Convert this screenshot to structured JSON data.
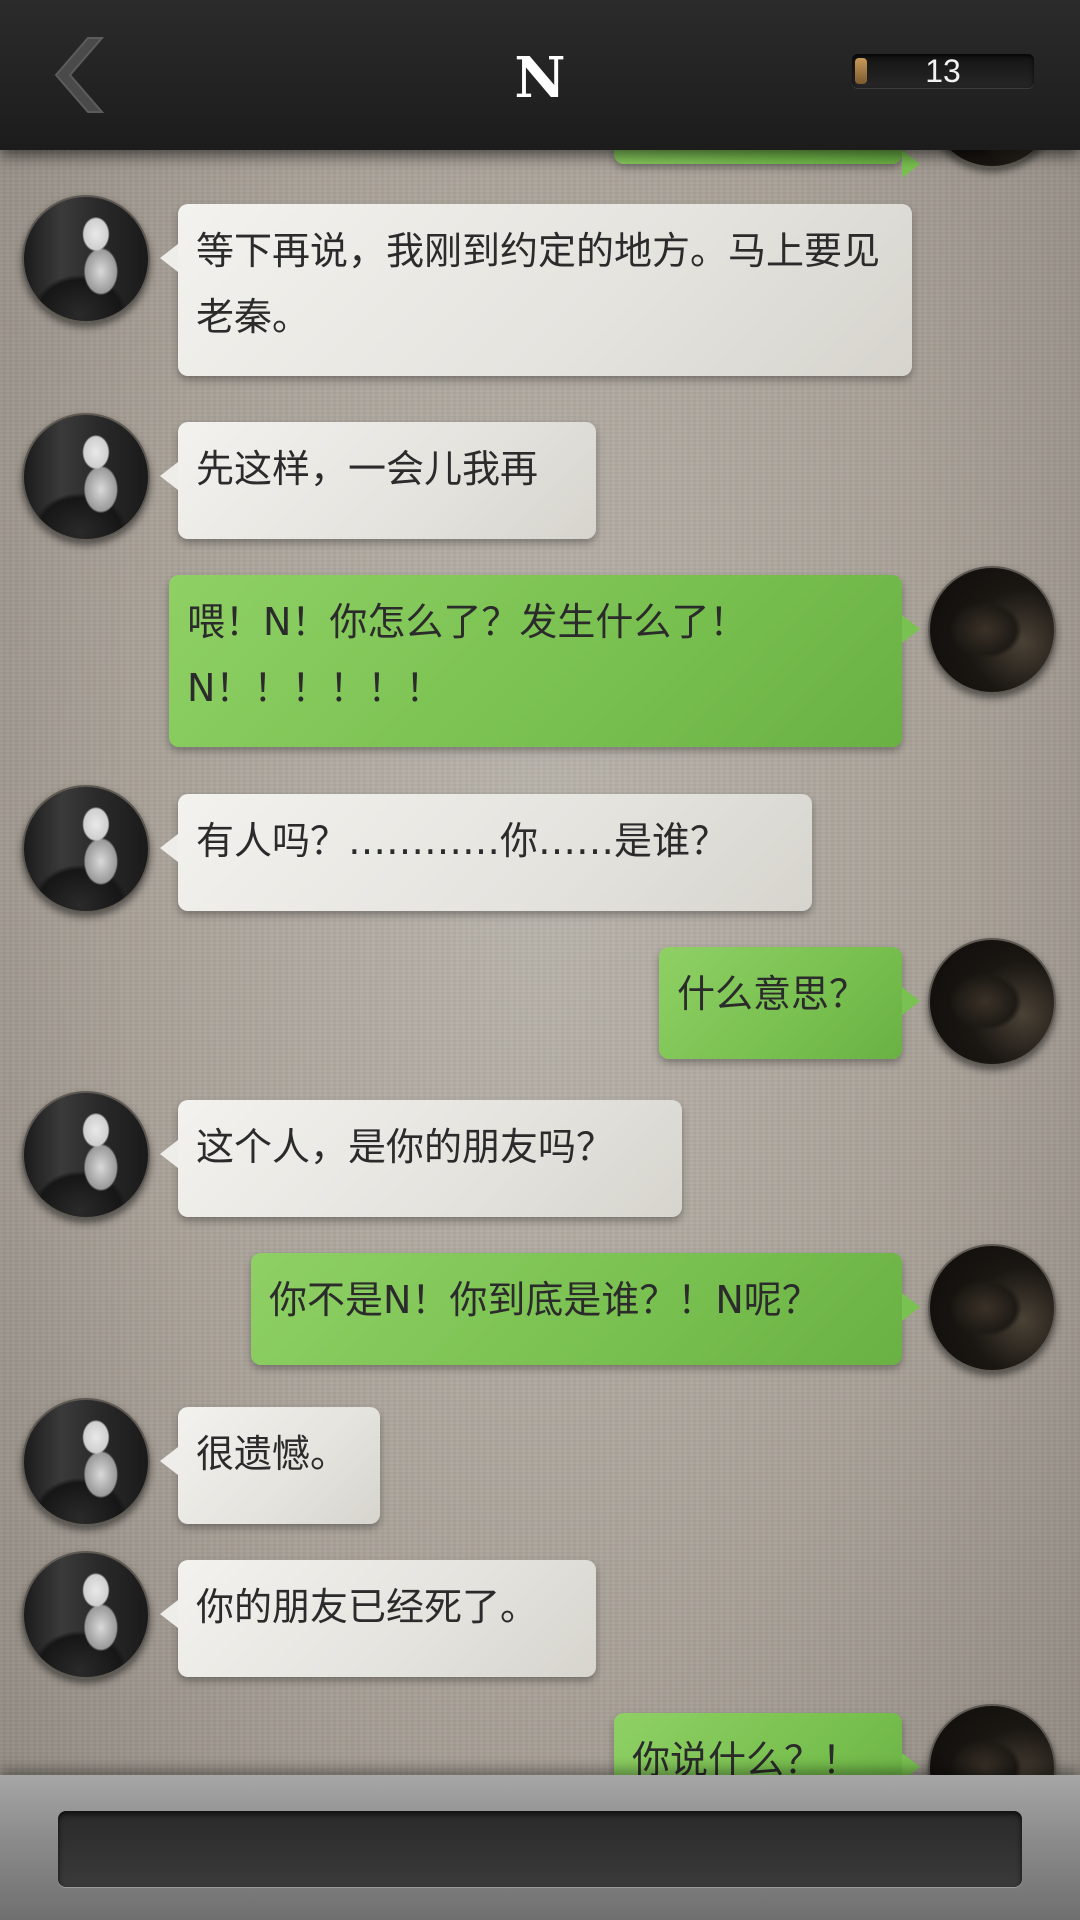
{
  "header": {
    "title": "N",
    "counter_value": "13",
    "counter_fill_fraction": 0.07
  },
  "messages": [
    {
      "sender": "me",
      "text": ""
    },
    {
      "sender": "n",
      "text": "等下再说，我刚到约定的地方。马上要见老秦。"
    },
    {
      "sender": "n",
      "text": "先这样，一会儿我再"
    },
    {
      "sender": "me",
      "text": "喂！N！你怎么了？发生什么了！N！！！！！！"
    },
    {
      "sender": "n",
      "text": "有人吗？…………你……是谁？"
    },
    {
      "sender": "me",
      "text": "什么意思？"
    },
    {
      "sender": "n",
      "text": "这个人，是你的朋友吗？"
    },
    {
      "sender": "me",
      "text": "你不是N！你到底是谁？！N呢？"
    },
    {
      "sender": "n",
      "text": "很遗憾。"
    },
    {
      "sender": "n",
      "text": "你的朋友已经死了。"
    },
    {
      "sender": "me",
      "text": "你说什么？！"
    }
  ],
  "input": {
    "value": ""
  },
  "colors": {
    "header_bg": "#232323",
    "bubble_in": "#eeede9",
    "bubble_out": "#7bc351",
    "background": "#aaa49b"
  },
  "icons": {
    "back": "chevron-left-icon"
  }
}
